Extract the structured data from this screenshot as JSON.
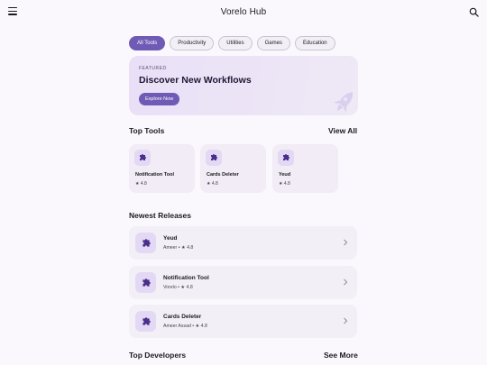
{
  "app": {
    "title": "Vorelo Hub"
  },
  "categories": [
    {
      "label": "All Tools",
      "active": true
    },
    {
      "label": "Productivity",
      "active": false
    },
    {
      "label": "Utilities",
      "active": false
    },
    {
      "label": "Games",
      "active": false
    },
    {
      "label": "Education",
      "active": false
    }
  ],
  "hero": {
    "eyebrow": "FEATURED",
    "headline": "Discover New Workflows",
    "cta": "Explore Now",
    "icon": "rocket-icon"
  },
  "top_tools": {
    "title": "Top Tools",
    "link": "View All",
    "items": [
      {
        "name": "Notification Tool",
        "rating": "★ 4.8",
        "icon": "puzzle-icon"
      },
      {
        "name": "Cards Deleter",
        "rating": "★ 4.8",
        "icon": "puzzle-icon"
      },
      {
        "name": "Yeud",
        "rating": "★ 4.8",
        "icon": "puzzle-icon"
      }
    ]
  },
  "newest": {
    "title": "Newest Releases",
    "items": [
      {
        "name": "Yeud",
        "meta": "Ameer • ★ 4.8",
        "icon": "puzzle-icon"
      },
      {
        "name": "Notification Tool",
        "meta": "Vorelo • ★ 4.8",
        "icon": "puzzle-icon"
      },
      {
        "name": "Cards Deleter",
        "meta": "Ameer Assad • ★ 4.8",
        "icon": "puzzle-icon"
      }
    ]
  },
  "top_developers": {
    "title": "Top Developers",
    "link": "See More"
  },
  "colors": {
    "accent": "#6f5ab5",
    "surface": "#f3eff7",
    "icon_tint": "#4a2f8c"
  }
}
